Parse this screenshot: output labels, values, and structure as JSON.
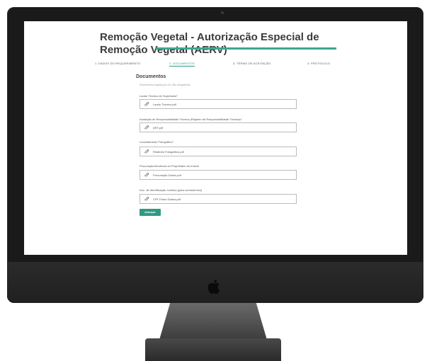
{
  "page": {
    "title": "Remoção Vegetal - Autorização Especial de Remoção Vegetal (AERV)"
  },
  "steps": [
    {
      "label": "1. DADOS DO REQUERIMENTO",
      "active": false
    },
    {
      "label": "2. DOCUMENTOS",
      "active": true
    },
    {
      "label": "3. TERMO DE ACEITAÇÃO",
      "active": false
    },
    {
      "label": "4. PROTOCOLO",
      "active": false
    }
  ],
  "documents": {
    "title": "Documentos",
    "hint": "Documentos exigidos por lei. São obrigatórios.",
    "fields": [
      {
        "label": "Laudo Técnico de Supressão*",
        "file": "Laudo Técnico.pdf"
      },
      {
        "label": "Anotação de Responsabilidade Técnica (Registro de Responsabilidade Técnica)*",
        "file": "ART.pdf"
      },
      {
        "label": "Levantamento Fotográfico*",
        "file": "Relatório Fotográfico.pdf"
      },
      {
        "label": "Procuração/Anuência do Proprietário do Imóvel",
        "file": "Procuração Dados.pdf"
      },
      {
        "label": "Doc. de Identificação Jurídica (para condomínios)",
        "file": "CPF Ponto Dados.pdf"
      }
    ]
  },
  "submit_label": "Avançar",
  "colors": {
    "accent": "#2f9a82",
    "bezel": "#1a1a1a"
  }
}
